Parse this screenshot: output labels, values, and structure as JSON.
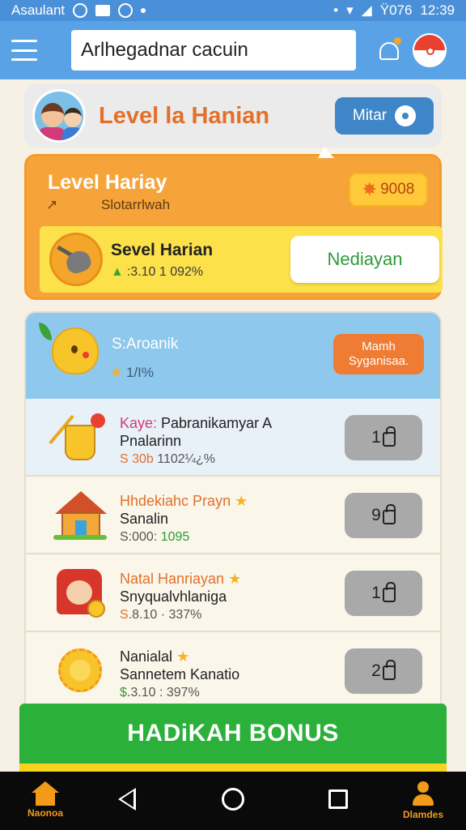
{
  "status_bar": {
    "carrier": "Asaulant",
    "battery": "Ÿ076",
    "time": "12:39"
  },
  "app_bar": {
    "search_value": "Arlhegadnar cacuin"
  },
  "level_header": {
    "title": "Level la Hanian",
    "button_label": "Mitar"
  },
  "daily_card": {
    "title": "Level Hariay",
    "subtitle": "Slotarrlwah",
    "coins": "9008",
    "strip_title": "Sevel Harian",
    "strip_meta": ":3.10 1 092%",
    "action_label": "Nediayan"
  },
  "list": {
    "header_title": "S:Aroanik",
    "header_meta": "1/I%",
    "header_button_line1": "Mamh",
    "header_button_line2": "Syganisaa.",
    "rows": [
      {
        "title_a": "Kaye:",
        "title_b": " Pabranikamyar A",
        "subtitle": "Pnalarinn",
        "meta_a": "S 30b",
        "meta_b": " 1102¼¿%",
        "button": "1"
      },
      {
        "title_a": "Hhdekiahc Prayn",
        "title_b": "",
        "subtitle": "Sanalin",
        "meta_a": "S:000:",
        "meta_b": " 1095",
        "button": "9"
      },
      {
        "title_a": "Natal Hanriayan",
        "title_b": "",
        "subtitle": "Snyqualvhlaniga",
        "meta_a": "S",
        "meta_b": ".8.10 · 337%",
        "button": "1"
      },
      {
        "title_a": "Nanialal",
        "title_b": "",
        "subtitle": "Sannetem Kanatio",
        "meta_a": "$",
        "meta_b": ".3.10 : 397%",
        "button": "2"
      }
    ]
  },
  "bonus_label": "HADiKAH BONUS",
  "nav": {
    "home_label": "Naonoa",
    "profile_label": "Dlamdes"
  },
  "colors": {
    "primary_blue": "#5aa2e6",
    "accent_orange": "#f6a43a",
    "bonus_green": "#2bb03a"
  }
}
